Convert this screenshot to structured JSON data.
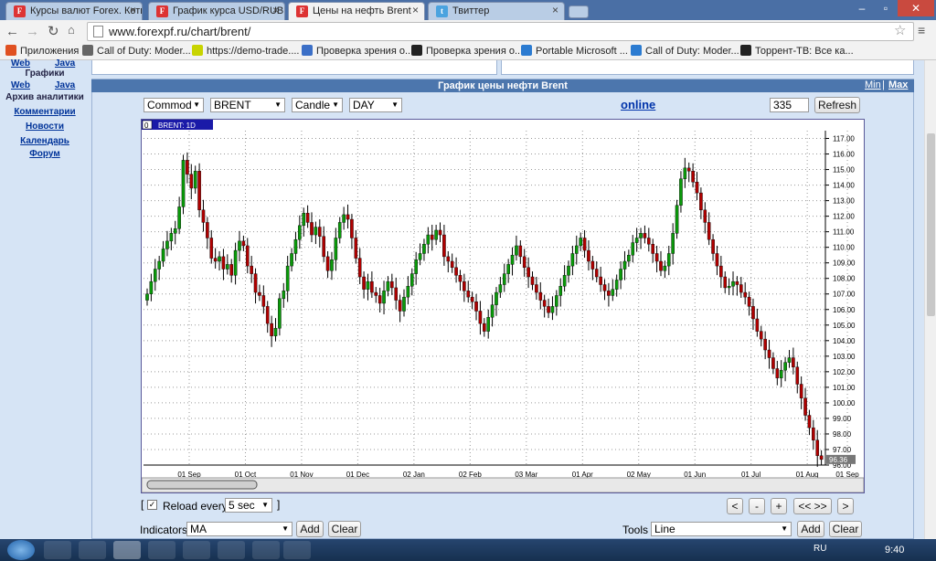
{
  "browser": {
    "tabs": [
      {
        "title": "Курсы валют Forex. Коти",
        "fav": "F",
        "color": "#d33"
      },
      {
        "title": "График курса USD/RUB",
        "fav": "F",
        "color": "#d33"
      },
      {
        "title": "Цены на нефть Brent",
        "fav": "F",
        "color": "#d33"
      },
      {
        "title": "Твиттер",
        "fav": "t",
        "color": "#4aa3df"
      }
    ],
    "url": "www.forexpf.ru/chart/brent/",
    "bookmarks": [
      {
        "label": "Приложения",
        "color": "#e05020"
      },
      {
        "label": "Call of Duty: Moder...",
        "color": "#666"
      },
      {
        "label": "https://demo-trade....",
        "color": "#c8d400"
      },
      {
        "label": "Проверка зрения о...",
        "color": "#3b6fc7"
      },
      {
        "label": "Проверка зрения о...",
        "color": "#222"
      },
      {
        "label": "Portable Microsoft ...",
        "color": "#2b7bd1"
      },
      {
        "label": "Call of Duty: Moder...",
        "color": "#2b7bd1"
      },
      {
        "label": "Торрент-ТВ: Все ка...",
        "color": "#222"
      }
    ]
  },
  "sidebar": {
    "items": [
      "Web",
      "Java",
      "Графики",
      "Web",
      "Java",
      "Архив аналитики",
      "Комментарии",
      "Новости",
      "Календарь",
      "Форум"
    ]
  },
  "panel": {
    "title": "График цены нефти Brent",
    "min": "Min",
    "sep": "|",
    "max": "Max",
    "commod": "Commod",
    "symbol": "BRENT",
    "type": "Candle",
    "period": "DAY",
    "online": "online",
    "count": "335",
    "refresh": "Refresh",
    "reload_label": "Reload every",
    "reload_value": "5 sec",
    "bracket_l": "[",
    "bracket_r": "]",
    "nav": [
      "<",
      "-",
      "+",
      "<< >>",
      ">"
    ],
    "indicators_label": "Indicators",
    "indicator": "MA",
    "add": "Add",
    "clear": "Clear",
    "tools_label": "Tools",
    "tool": "Line"
  },
  "chart_data": {
    "type": "candlestick",
    "legend": "BRENT: 1D",
    "legend_box": "0",
    "ylim": [
      96,
      117.5
    ],
    "yticks": [
      "117.00",
      "116.00",
      "115.00",
      "114.00",
      "113.00",
      "112.00",
      "111.00",
      "110.00",
      "109.00",
      "108.00",
      "107.00",
      "106.00",
      "105.00",
      "104.00",
      "103.00",
      "102.00",
      "101.00",
      "100.00",
      "99.00",
      "98.00",
      "97.00",
      "96.00"
    ],
    "xticks": [
      "01 Sep",
      "01 Oct",
      "01 Nov",
      "01 Dec",
      "02 Jan",
      "02 Feb",
      "03 Mar",
      "01 Apr",
      "02 May",
      "01 Jun",
      "01 Jul",
      "01 Aug",
      "01 Sep"
    ],
    "last_price": "96.36",
    "close": [
      107,
      107.8,
      108.6,
      109.1,
      109.9,
      110.4,
      110.9,
      111.2,
      112.6,
      115.6,
      114.7,
      113.8,
      114.9,
      112.4,
      111.6,
      110.6,
      109.3,
      109.1,
      109.4,
      108.6,
      108.9,
      108.2,
      109.8,
      110.4,
      110.1,
      108.8,
      108.3,
      107.1,
      106.9,
      106.2,
      105.1,
      104.3,
      104.8,
      106.7,
      107.2,
      108.8,
      109.6,
      110.5,
      111.4,
      112.2,
      111.6,
      110.8,
      111.3,
      110.7,
      109.4,
      108.5,
      109.2,
      110.6,
      111.6,
      112.1,
      111.8,
      110.6,
      109.3,
      108.1,
      107.3,
      107.8,
      107.1,
      106.9,
      106.4,
      107.2,
      107.8,
      107.4,
      106.6,
      105.9,
      106.8,
      107.5,
      108.3,
      109.2,
      109.6,
      110.2,
      110.8,
      110.5,
      111.1,
      110.8,
      109.4,
      109.1,
      108.7,
      108.2,
      107.8,
      107.2,
      106.8,
      106.5,
      105.9,
      105.1,
      104.6,
      105.5,
      106.3,
      107.1,
      107.6,
      108.3,
      108.9,
      109.5,
      110.1,
      109.4,
      108.7,
      108.1,
      107.6,
      107.1,
      106.6,
      106.2,
      105.8,
      106.2,
      106.9,
      107.5,
      108.2,
      108.8,
      109.6,
      110.1,
      110.6,
      109.8,
      109.1,
      108.6,
      108.1,
      107.6,
      107.2,
      106.9,
      107.3,
      107.9,
      108.6,
      109.1,
      109.5,
      110.3,
      110.6,
      110.9,
      110.6,
      110.2,
      109.6,
      109.1,
      108.5,
      108.8,
      109.6,
      110.9,
      112.7,
      114.4,
      115.1,
      114.9,
      114.2,
      113.5,
      112.4,
      111.6,
      110.5,
      109.6,
      108.8,
      108.1,
      107.4,
      107.5,
      107.8,
      107.6,
      107.1,
      106.8,
      106.2,
      105.4,
      104.6,
      104.1,
      103.4,
      102.9,
      102.2,
      101.6,
      102.1,
      102.6,
      102.9,
      102.3,
      101.2,
      100.3,
      99.2,
      98.4,
      97.6,
      96.6,
      96.36
    ]
  }
}
